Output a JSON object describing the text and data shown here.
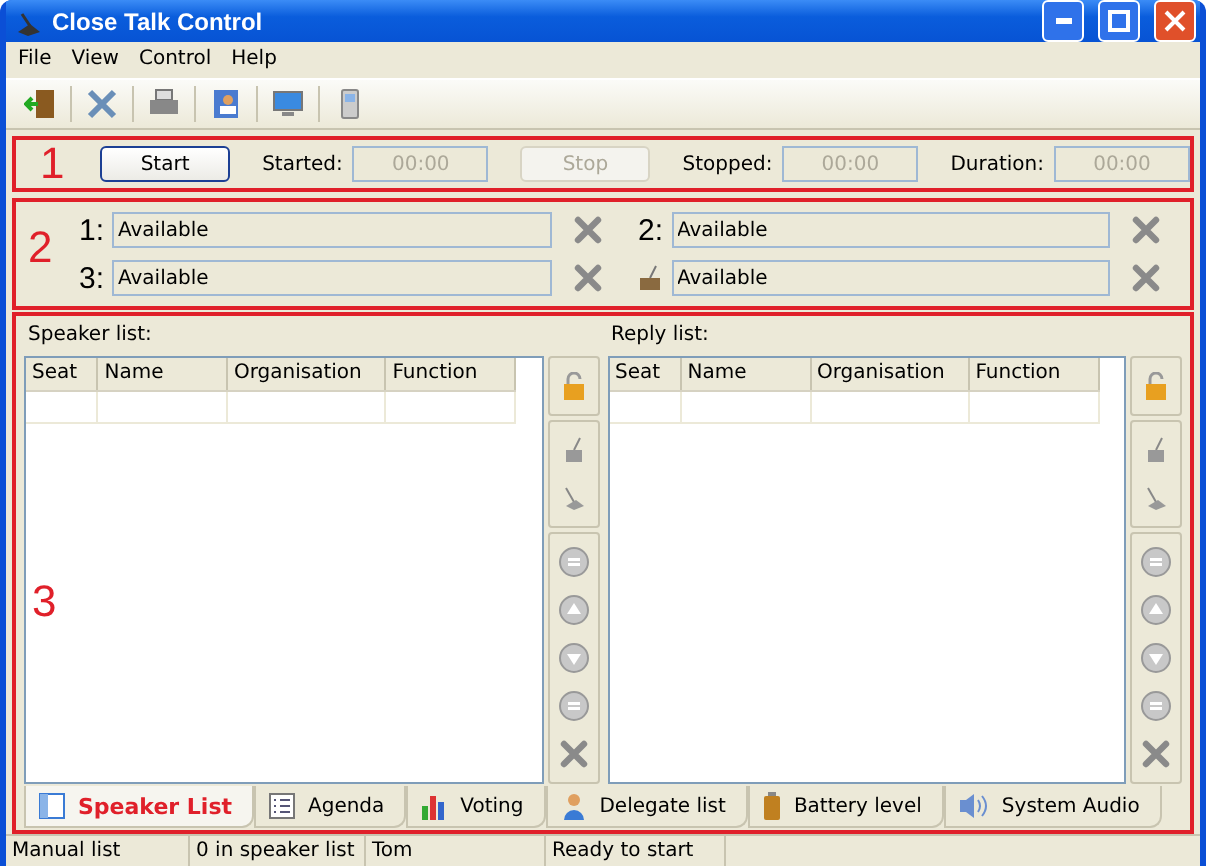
{
  "window": {
    "title": "Close Talk Control"
  },
  "menu": [
    "File",
    "View",
    "Control",
    "Help"
  ],
  "sections": [
    {
      "number": "1"
    },
    {
      "number": "2"
    },
    {
      "number": "3"
    }
  ],
  "timer": {
    "start": {
      "label": "Start",
      "disabled": false
    },
    "started": {
      "label": "Started:",
      "value": "00:00",
      "disabled": true
    },
    "stop": {
      "label": "Stop",
      "disabled": true
    },
    "stopped": {
      "label": "Stopped:",
      "value": "00:00",
      "disabled": true
    },
    "duration": {
      "label": "Duration:",
      "value": "00:00",
      "disabled": true
    }
  },
  "slots": [
    {
      "kind": "numbered",
      "label": "1:",
      "value": "Available"
    },
    {
      "kind": "numbered",
      "label": "2:",
      "value": "Available"
    },
    {
      "kind": "numbered",
      "label": "3:",
      "value": "Available"
    },
    {
      "kind": "chair",
      "value": "Available"
    }
  ],
  "speaker_list": {
    "label": "Speaker list:",
    "columns": [
      "Seat",
      "Name",
      "Organisation",
      "Function"
    ]
  },
  "reply_list": {
    "label": "Reply list:",
    "columns": [
      "Seat",
      "Name",
      "Organisation",
      "Function"
    ]
  },
  "tabs": [
    {
      "label": "Speaker List",
      "kind": "list",
      "selected": true
    },
    {
      "label": "Agenda",
      "kind": "agenda",
      "selected": false
    },
    {
      "label": "Voting",
      "kind": "chart",
      "selected": false
    },
    {
      "label": "Delegate list",
      "kind": "person",
      "selected": false
    },
    {
      "label": "Battery level",
      "kind": "battery",
      "selected": false
    },
    {
      "label": "System Audio",
      "kind": "speaker",
      "selected": false
    }
  ],
  "status_bar": [
    "Manual list",
    "0 in speaker list",
    "Tom",
    "Ready to start"
  ]
}
